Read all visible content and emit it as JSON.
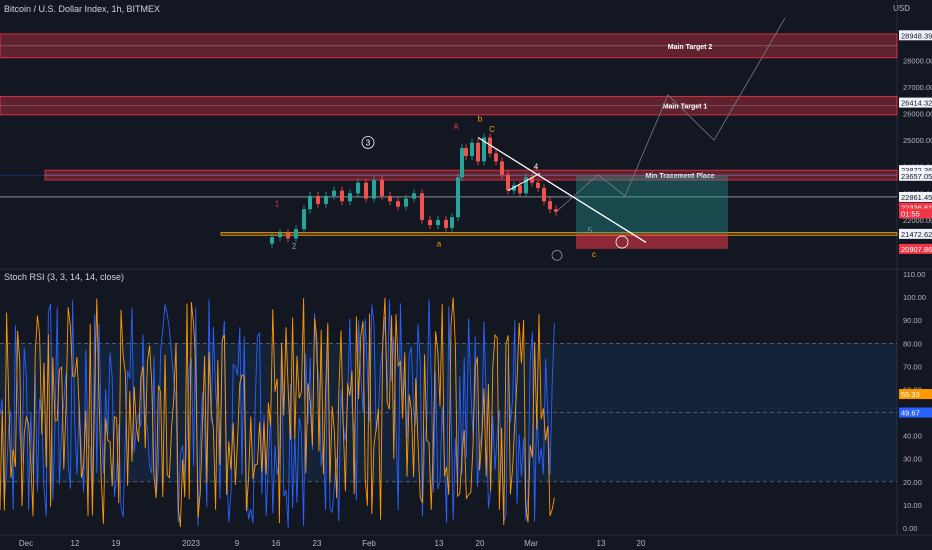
{
  "header": {
    "symbol": "Bitcoin / U.S. Dollar Index, 1h, BITMEX",
    "currency": "USD"
  },
  "rsi_header": "Stoch RSI (3, 3, 14, 14, close)",
  "chart_data": [
    {
      "type": "line",
      "name": "price",
      "ylim": [
        20300,
        29900
      ],
      "yticks": [
        21000,
        22000,
        23000,
        24000,
        25000,
        26000,
        27000,
        28000
      ],
      "xlabels": [
        "Dec",
        "12",
        "19",
        "2023",
        "9",
        "16",
        "23",
        "Feb",
        "13",
        "20",
        "Mar",
        "13",
        "20"
      ],
      "price_labels": [
        {
          "text": "28948.39",
          "value": 28948,
          "color": "#f0f3fa",
          "text_color": "#131722"
        },
        {
          "text": "26414.32",
          "value": 26414,
          "color": "#f0f3fa",
          "text_color": "#131722"
        },
        {
          "text": "23872.36",
          "value": 23872,
          "color": "#f0f3fa",
          "text_color": "#131722"
        },
        {
          "text": "23657.05",
          "value": 23657,
          "color": "#f0f3fa",
          "text_color": "#131722"
        },
        {
          "text": "22861.45",
          "value": 22861,
          "color": "#f0f3fa",
          "text_color": "#131722"
        },
        {
          "text": "22336.61",
          "value": 22460,
          "color": "#f23645",
          "text_color": "#ffffff"
        },
        {
          "text": "01:55",
          "value": 22240,
          "color": "#f23645",
          "text_color": "#ffffff"
        },
        {
          "text": "21472.62",
          "value": 21472,
          "color": "#f0f3fa",
          "text_color": "#131722"
        },
        {
          "text": "20907.86",
          "value": 20907,
          "color": "#f23645",
          "text_color": "#ffffff"
        }
      ],
      "zones": [
        {
          "label": "Main Target 2",
          "y_low": 28100,
          "y_high": 29000,
          "color": "#f23645"
        },
        {
          "label": "Main Target 1",
          "y_low": 25950,
          "y_high": 26650,
          "color": "#f23645"
        },
        {
          "label": "Min Tracement Place",
          "y_low": 23500,
          "y_high": 23870,
          "color": "#f23645"
        }
      ],
      "waves": [
        {
          "label": "1"
        },
        {
          "label": "2"
        },
        {
          "label": "3"
        },
        {
          "label": "4"
        },
        {
          "label": "5"
        },
        {
          "label": "a"
        },
        {
          "label": "b"
        },
        {
          "label": "c"
        },
        {
          "label": "A"
        },
        {
          "label": "C"
        }
      ],
      "colors": {
        "up": "#26a69a",
        "down": "#ef5350",
        "wave_orange": "#f7a600"
      }
    },
    {
      "type": "line",
      "name": "stoch_rsi",
      "ylim": [
        0,
        110
      ],
      "yticks": [
        0,
        10,
        20,
        30,
        40,
        50,
        60,
        70,
        80,
        90,
        100,
        110
      ],
      "band": [
        20,
        80
      ],
      "current": {
        "k": "55.33",
        "d": "49.67",
        "k_value": 58,
        "d_value": 50
      },
      "series": [
        {
          "color": "#2962ff"
        },
        {
          "color": "#ff9800"
        }
      ]
    }
  ]
}
